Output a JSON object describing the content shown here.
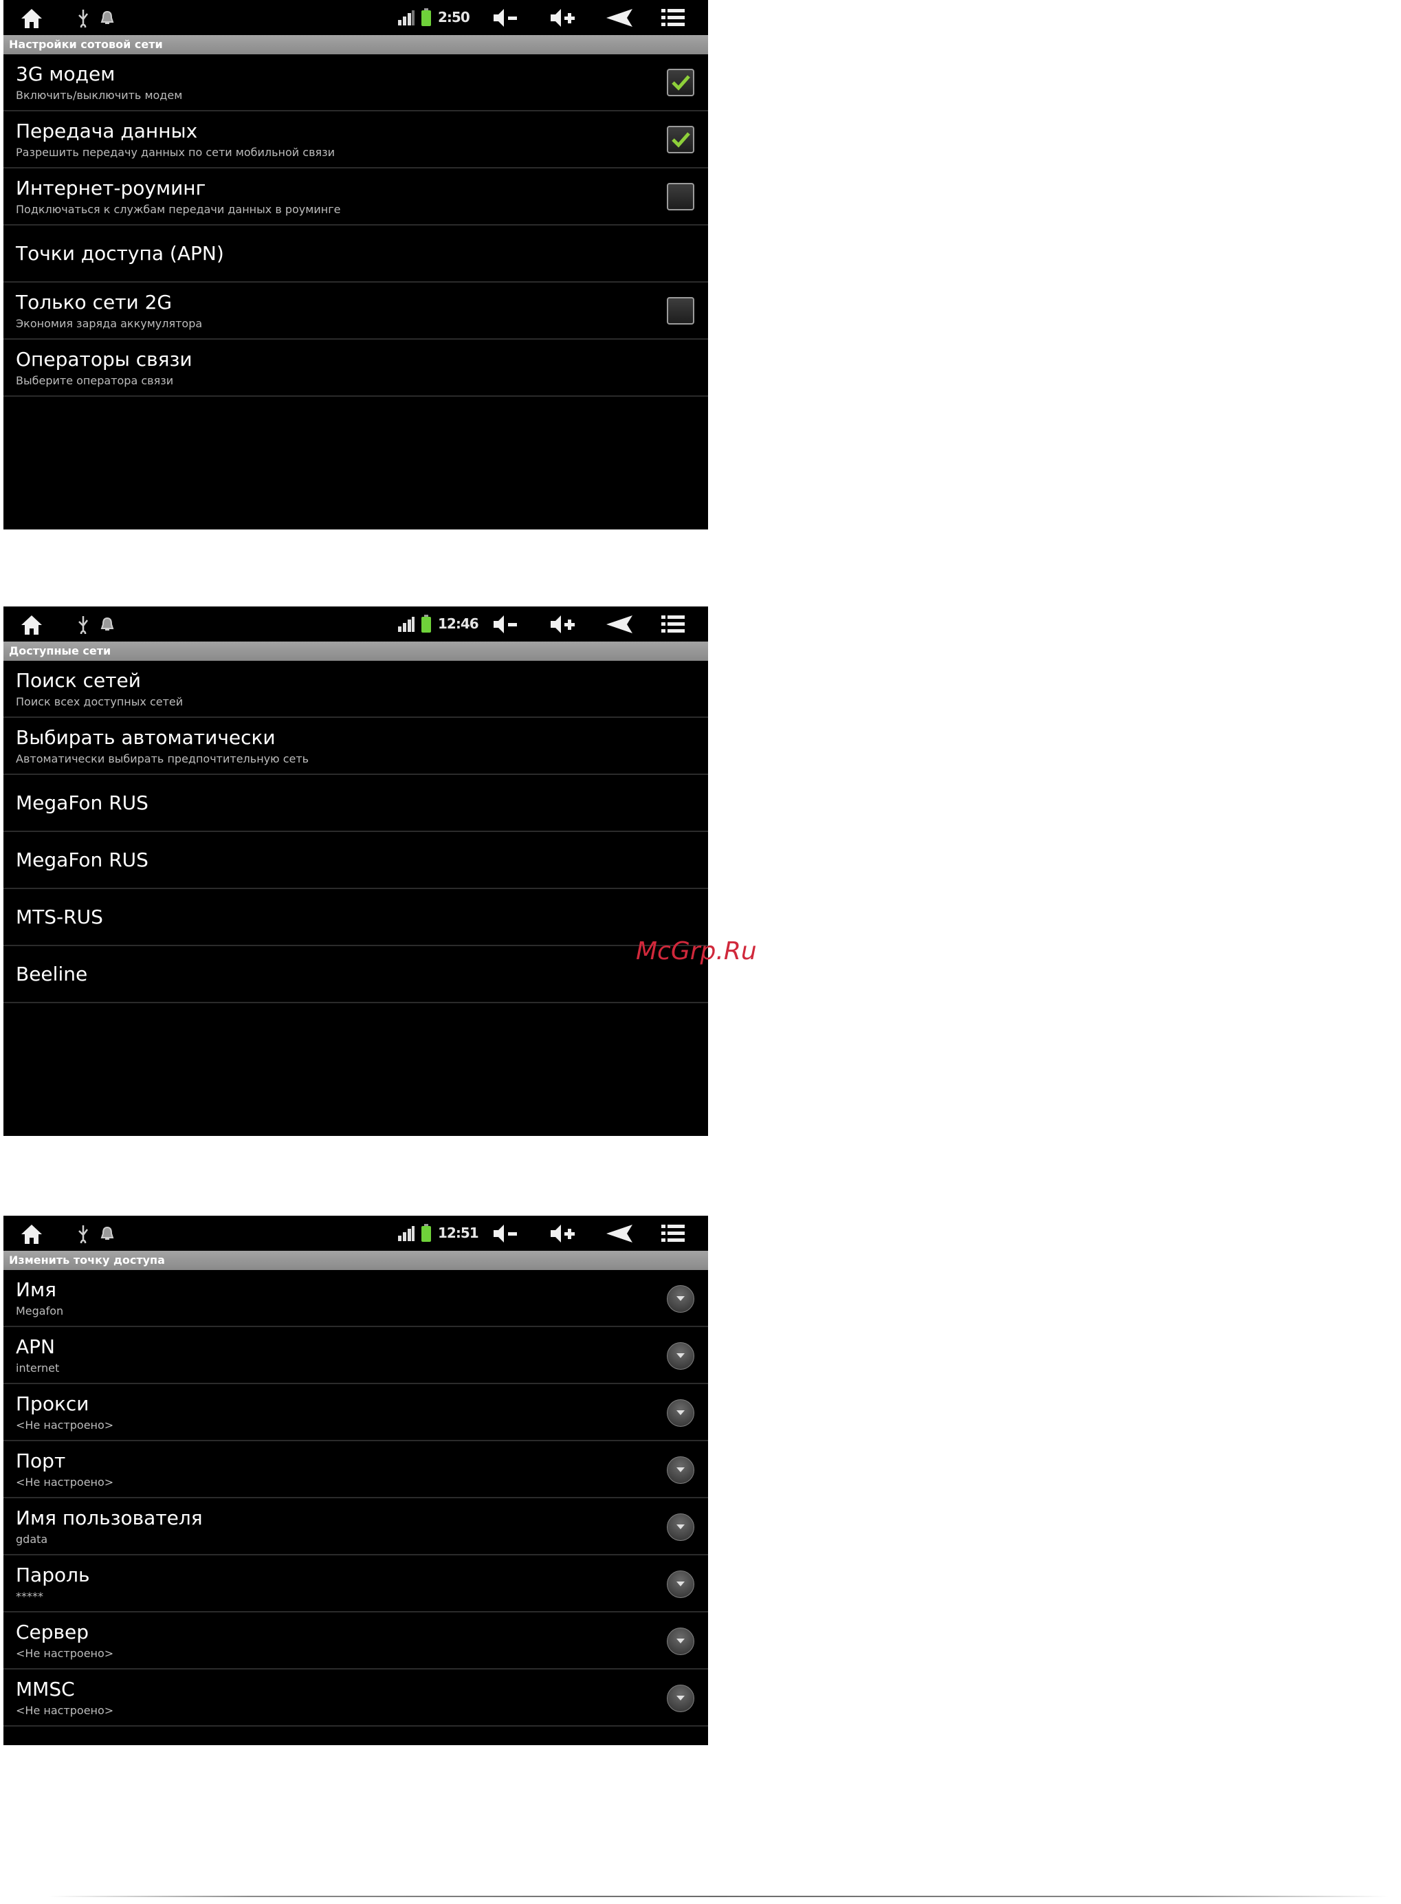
{
  "screens": [
    {
      "status": {
        "time": "2:50"
      },
      "title": "Настройки сотовой сети",
      "items": [
        {
          "title": "3G модем",
          "subtitle": "Включить/выключить модем",
          "checked": true
        },
        {
          "title": "Передача данных",
          "subtitle": "Разрешить передачу данных по сети мобильной связи",
          "checked": true
        },
        {
          "title": "Интернет-роуминг",
          "subtitle": "Подключаться к службам передачи данных в роуминге",
          "checked": false
        },
        {
          "title": "Точки доступа (APN)"
        },
        {
          "title": "Только сети 2G",
          "subtitle": "Экономия заряда аккумулятора",
          "checked": false
        },
        {
          "title": "Операторы связи",
          "subtitle": "Выберите оператора связи"
        }
      ]
    },
    {
      "status": {
        "time": "12:46"
      },
      "title": "Доступные сети",
      "items": [
        {
          "title": "Поиск сетей",
          "subtitle": "Поиск всех доступных сетей"
        },
        {
          "title": "Выбирать автоматически",
          "subtitle": "Автоматически выбирать предпочтительную сеть"
        },
        {
          "title": "MegaFon RUS"
        },
        {
          "title": "MegaFon RUS"
        },
        {
          "title": "MTS-RUS"
        },
        {
          "title": "Beeline"
        }
      ]
    },
    {
      "status": {
        "time": "12:51"
      },
      "title": "Изменить точку доступа",
      "items": [
        {
          "title": "Имя",
          "value": "Megafon"
        },
        {
          "title": "APN",
          "value": "internet"
        },
        {
          "title": "Прокси",
          "value": "<Не настроено>"
        },
        {
          "title": "Порт",
          "value": "<Не настроено>"
        },
        {
          "title": "Имя пользователя",
          "value": "gdata"
        },
        {
          "title": "Пароль",
          "value": "*****"
        },
        {
          "title": "Сервер",
          "value": "<Не настроено>"
        },
        {
          "title": "MMSC",
          "value": "<Не настроено>"
        }
      ]
    }
  ],
  "watermark": "McGrp.Ru",
  "icons": [
    "home-icon",
    "usb-icon",
    "notification-icon",
    "signal-icon",
    "battery-icon",
    "volume-down-icon",
    "volume-up-icon",
    "back-icon",
    "menu-icon",
    "checkmark-icon",
    "chevron-down-icon"
  ],
  "colors": {
    "accent_check": "#8ed03a",
    "battery": "#6fd23a",
    "titlebar": "#9a9a9a",
    "background": "#000000",
    "watermark": "#d0283b"
  }
}
